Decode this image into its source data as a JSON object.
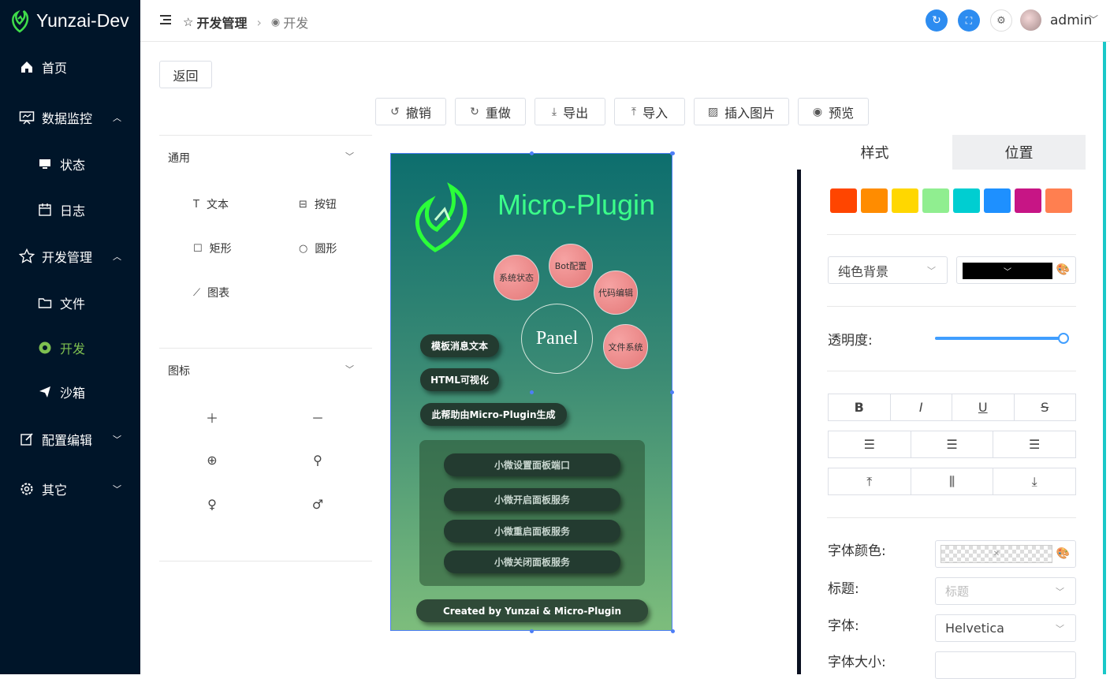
{
  "brand": {
    "title": "Yunzai-Dev"
  },
  "sidebar": {
    "items": [
      {
        "label": "首页"
      },
      {
        "label": "数据监控"
      },
      {
        "label": "状态"
      },
      {
        "label": "日志"
      },
      {
        "label": "开发管理"
      },
      {
        "label": "文件"
      },
      {
        "label": "开发"
      },
      {
        "label": "沙箱"
      },
      {
        "label": "配置编辑"
      },
      {
        "label": "其它"
      }
    ],
    "active_color": "#7ec050"
  },
  "header": {
    "breadcrumb": [
      "开发管理",
      "开发"
    ],
    "user": "admin"
  },
  "toolbar": {
    "back": "返回",
    "undo": "撤销",
    "redo": "重做",
    "export": "导出",
    "import": "导入",
    "insert_image": "插入图片",
    "preview": "预览"
  },
  "components": {
    "general_title": "通用",
    "items": [
      "文本",
      "按钮",
      "矩形",
      "圆形",
      "图表"
    ],
    "icons_title": "图标"
  },
  "canvas": {
    "title": "Micro-Plugin",
    "bubbles": [
      "Bot配置",
      "系统状态",
      "代码编辑",
      "文件系统"
    ],
    "center": "Panel",
    "pills": [
      "模板消息文本",
      "HTML可视化",
      "此帮助由Micro-Plugin生成"
    ],
    "inner_pills": [
      "小微设置面板端口",
      "小微开启面板服务",
      "小微重启面板服务",
      "小微关闭面板服务"
    ],
    "footer": "Created by Yunzai & Micro-Plugin"
  },
  "props": {
    "tabs": [
      "样式",
      "位置"
    ],
    "swatches": [
      "#ff4500",
      "#ff8c00",
      "#ffd700",
      "#90ee90",
      "#00ced1",
      "#1e90ff",
      "#c71585",
      "#ff7f50"
    ],
    "background_select": "纯色背景",
    "opacity_label": "透明度:",
    "opacity_value": 1,
    "format": [
      "B",
      "I",
      "U",
      "S"
    ],
    "font_color_label": "字体颜色:",
    "title_label": "标题:",
    "title_placeholder": "标题",
    "font_label": "字体:",
    "font_value": "Helvetica",
    "font_size_label": "字体大小:"
  }
}
